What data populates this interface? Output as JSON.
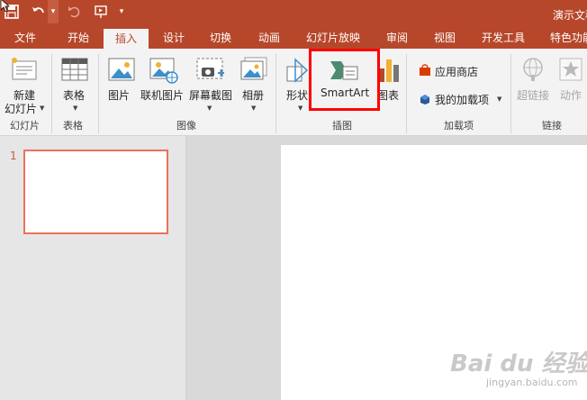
{
  "window": {
    "title": "演示文稿"
  },
  "tabs": [
    "文件",
    "开始",
    "插入",
    "设计",
    "切换",
    "动画",
    "幻灯片放映",
    "审阅",
    "视图",
    "开发工具",
    "特色功能"
  ],
  "ribbon": {
    "slides_group": {
      "new_slide_line1": "新建",
      "new_slide_line2": "幻灯片",
      "label": "幻灯片"
    },
    "tables_group": {
      "table": "表格",
      "label": "表格"
    },
    "images_group": {
      "picture": "图片",
      "online_picture": "联机图片",
      "screenshot": "屏幕截图",
      "album": "相册",
      "label": "图像"
    },
    "illustrations_group": {
      "shapes": "形状",
      "smartart": "SmartArt",
      "chart": "图表",
      "label": "插图"
    },
    "addins_group": {
      "store": "应用商店",
      "my_addins": "我的加载项",
      "label": "加载项"
    },
    "links_group": {
      "hyperlink": "超链接",
      "action": "动作",
      "label": "链接"
    }
  },
  "slides_pane": {
    "slide_number": "1"
  },
  "watermark": {
    "brand": "Bai du 经验",
    "url": "jingyan.baidu.com"
  }
}
